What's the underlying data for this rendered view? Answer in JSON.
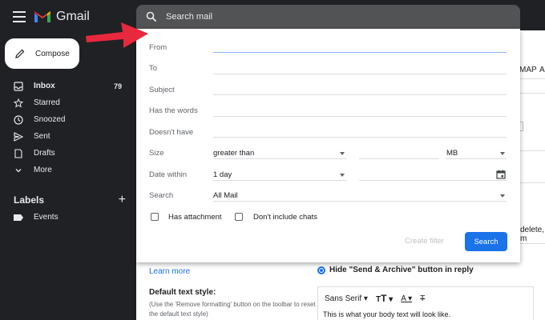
{
  "app": {
    "title": "Gmail"
  },
  "sidebar": {
    "compose_label": "Compose",
    "items": [
      {
        "label": "Inbox",
        "count": "79",
        "icon": "inbox-icon"
      },
      {
        "label": "Starred",
        "icon": "star-icon"
      },
      {
        "label": "Snoozed",
        "icon": "clock-icon"
      },
      {
        "label": "Sent",
        "icon": "send-icon"
      },
      {
        "label": "Drafts",
        "icon": "draft-icon"
      },
      {
        "label": "More",
        "icon": "chevron-down-icon"
      }
    ],
    "labels_heading": "Labels",
    "labels": [
      {
        "label": "Events",
        "icon": "label-icon"
      }
    ]
  },
  "search": {
    "placeholder": "Search mail",
    "fields": {
      "from_label": "From",
      "to_label": "To",
      "subject_label": "Subject",
      "has_words_label": "Has the words",
      "doesnt_have_label": "Doesn't have",
      "size_label": "Size",
      "size_operator": "greater than",
      "size_value": "",
      "size_unit": "MB",
      "date_within_label": "Date within",
      "date_within_value": "1 day",
      "date_value": "",
      "search_in_label": "Search",
      "search_in_value": "All Mail",
      "has_attachment_label": "Has attachment",
      "no_chats_label": "Don't include chats"
    },
    "create_filter_label": "Create filter",
    "search_button_label": "Search"
  },
  "background": {
    "frag_map": "MAP",
    "frag_a": "A",
    "frag_delete": "delete, m",
    "frag_reply": "y",
    "learn_more": "Learn more",
    "hide_send_archive": "Hide \"Send & Archive\" button in reply",
    "default_text_style": "Default text style:",
    "default_text_desc": "(Use the 'Remove formatting' button on the toolbar to reset the default text style)",
    "font_select": "Sans Serif",
    "sample_text": "This is what your body text will look like."
  },
  "colors": {
    "accent": "#1a73e8",
    "annotation_arrow": "#e8283c"
  }
}
